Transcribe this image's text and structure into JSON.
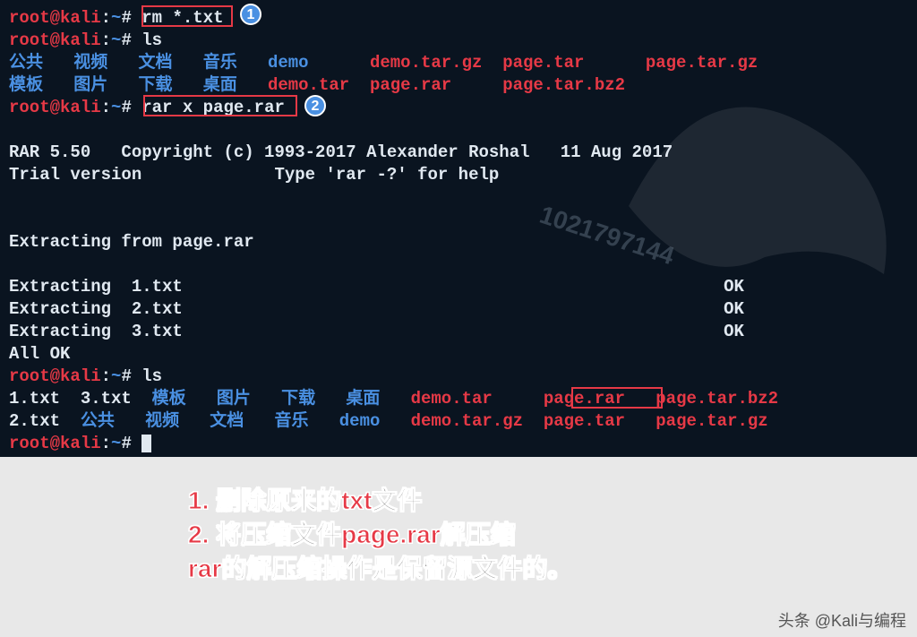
{
  "prompt": {
    "user": "root",
    "host": "kali",
    "sep1": "@",
    "sep2": ":",
    "path": "~",
    "hash": "#"
  },
  "cmd1": "rm *.txt",
  "cmd2": "ls",
  "ls1_row1": {
    "c1": "公共",
    "c2": "视频",
    "c3": "文档",
    "c4": "音乐",
    "c5": "demo",
    "c6": "demo.tar.gz",
    "c7": "page.tar",
    "c8": "page.tar.gz"
  },
  "ls1_row2": {
    "c1": "模板",
    "c2": "图片",
    "c3": "下载",
    "c4": "桌面",
    "c5": "demo.tar",
    "c6": "page.rar",
    "c7": "page.tar.bz2"
  },
  "cmd3": "rar x page.rar",
  "rar": {
    "banner1": "RAR 5.50   Copyright (c) 1993-2017 Alexander Roshal   11 Aug 2017",
    "banner2": "Trial version             Type 'rar -?' for help",
    "from": "Extracting from page.rar",
    "e1": "Extracting  1.txt",
    "e2": "Extracting  2.txt",
    "e3": "Extracting  3.txt",
    "ok": "OK",
    "allok": "All OK"
  },
  "cmd4": "ls",
  "ls2_row1": {
    "c1": "1.txt",
    "c2": "3.txt",
    "c3": "模板",
    "c4": "图片",
    "c5": "下载",
    "c6": "桌面",
    "c7": "demo.tar",
    "c8": "page.rar",
    "c9": "page.tar.bz2"
  },
  "ls2_row2": {
    "c1": "2.txt",
    "c2": "公共",
    "c3": "视频",
    "c4": "文档",
    "c5": "音乐",
    "c6": "demo",
    "c7": "demo.tar.gz",
    "c8": "page.tar",
    "c9": "page.tar.gz"
  },
  "badges": {
    "b1": "1",
    "b2": "2"
  },
  "watermark": "1021797144",
  "annotation": {
    "l1a": "1. ",
    "l1b": "删除原来的",
    "l1c": "txt",
    "l1d": "文件",
    "l2a": "2. ",
    "l2b": "将压缩文件",
    "l2c": "page.rar",
    "l2d": "解压缩",
    "l3a": "rar",
    "l3b": "的解压缩操作是保留源文件的。"
  },
  "footer": "头条 @Kali与编程"
}
